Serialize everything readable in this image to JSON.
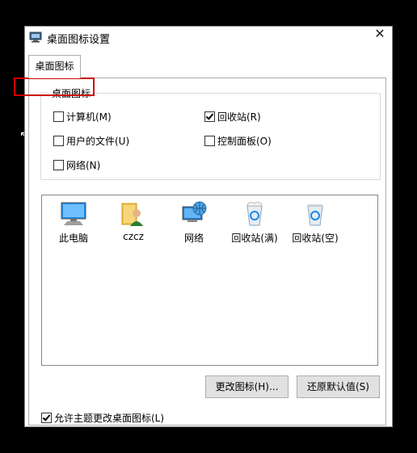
{
  "window": {
    "title": "桌面图标设置",
    "close_glyph": "✕"
  },
  "tabs": [
    {
      "label": "桌面图标"
    }
  ],
  "group": {
    "legend": "桌面图标",
    "items": [
      {
        "label": "计算机(M)",
        "checked": false
      },
      {
        "label": "回收站(R)",
        "checked": true
      },
      {
        "label": "用户的文件(U)",
        "checked": false
      },
      {
        "label": "控制面板(O)",
        "checked": false
      },
      {
        "label": "网络(N)",
        "checked": false
      }
    ]
  },
  "icons": [
    {
      "label": "此电脑",
      "icon": "computer-icon"
    },
    {
      "label": "czcz",
      "icon": "user-folder-icon"
    },
    {
      "label": "网络",
      "icon": "network-icon"
    },
    {
      "label": "回收站(满)",
      "icon": "recycle-bin-full-icon"
    },
    {
      "label": "回收站(空)",
      "icon": "recycle-bin-empty-icon"
    }
  ],
  "buttons": {
    "change_icon": "更改图标(H)...",
    "restore_default": "还原默认值(S)"
  },
  "theme_option": {
    "label": "允许主题更改桌面图标(L)",
    "checked": true
  },
  "colors": {
    "highlight": "#cc0000",
    "accent": "#0078d7"
  }
}
